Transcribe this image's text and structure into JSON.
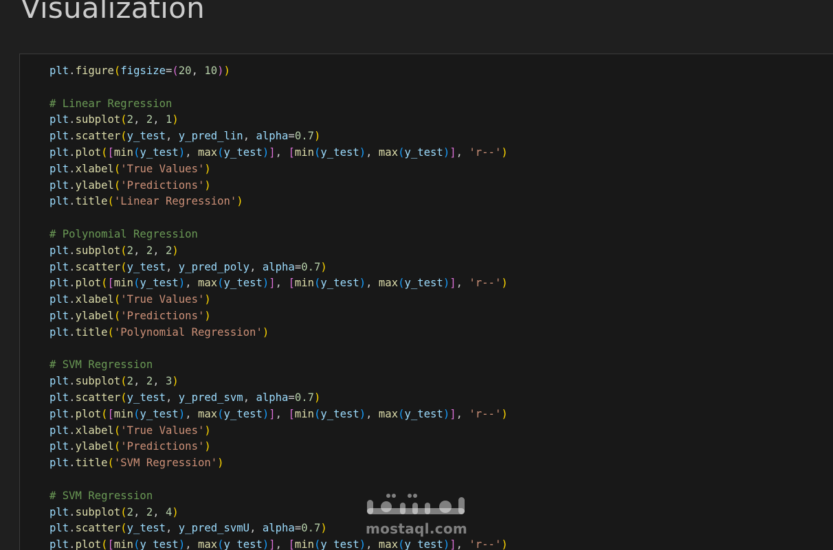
{
  "section": {
    "heading": "Visualization"
  },
  "code_cell": {
    "lines": [
      [
        [
          "plt",
          "var"
        ],
        [
          ".",
          "pun"
        ],
        [
          "figure",
          "fn"
        ],
        [
          "(",
          "b1"
        ],
        [
          "figsize",
          "var"
        ],
        [
          "=",
          "pun"
        ],
        [
          "(",
          "b2"
        ],
        [
          "20",
          "num"
        ],
        [
          ", ",
          "pun"
        ],
        [
          "10",
          "num"
        ],
        [
          ")",
          "b2"
        ],
        [
          ")",
          "b1"
        ]
      ],
      [],
      [
        [
          "# Linear Regression",
          "com"
        ]
      ],
      [
        [
          "plt",
          "var"
        ],
        [
          ".",
          "pun"
        ],
        [
          "subplot",
          "fn"
        ],
        [
          "(",
          "b1"
        ],
        [
          "2",
          "num"
        ],
        [
          ", ",
          "pun"
        ],
        [
          "2",
          "num"
        ],
        [
          ", ",
          "pun"
        ],
        [
          "1",
          "num"
        ],
        [
          ")",
          "b1"
        ]
      ],
      [
        [
          "plt",
          "var"
        ],
        [
          ".",
          "pun"
        ],
        [
          "scatter",
          "fn"
        ],
        [
          "(",
          "b1"
        ],
        [
          "y_test",
          "var"
        ],
        [
          ", ",
          "pun"
        ],
        [
          "y_pred_lin",
          "var"
        ],
        [
          ", ",
          "pun"
        ],
        [
          "alpha",
          "var"
        ],
        [
          "=",
          "pun"
        ],
        [
          "0.7",
          "num"
        ],
        [
          ")",
          "b1"
        ]
      ],
      [
        [
          "plt",
          "var"
        ],
        [
          ".",
          "pun"
        ],
        [
          "plot",
          "fn"
        ],
        [
          "(",
          "b1"
        ],
        [
          "[",
          "b2"
        ],
        [
          "min",
          "fn"
        ],
        [
          "(",
          "b3"
        ],
        [
          "y_test",
          "var"
        ],
        [
          ")",
          "b3"
        ],
        [
          ", ",
          "pun"
        ],
        [
          "max",
          "fn"
        ],
        [
          "(",
          "b3"
        ],
        [
          "y_test",
          "var"
        ],
        [
          ")",
          "b3"
        ],
        [
          "]",
          "b2"
        ],
        [
          ", ",
          "pun"
        ],
        [
          "[",
          "b2"
        ],
        [
          "min",
          "fn"
        ],
        [
          "(",
          "b3"
        ],
        [
          "y_test",
          "var"
        ],
        [
          ")",
          "b3"
        ],
        [
          ", ",
          "pun"
        ],
        [
          "max",
          "fn"
        ],
        [
          "(",
          "b3"
        ],
        [
          "y_test",
          "var"
        ],
        [
          ")",
          "b3"
        ],
        [
          "]",
          "b2"
        ],
        [
          ", ",
          "pun"
        ],
        [
          "'r--'",
          "str"
        ],
        [
          ")",
          "b1"
        ]
      ],
      [
        [
          "plt",
          "var"
        ],
        [
          ".",
          "pun"
        ],
        [
          "xlabel",
          "fn"
        ],
        [
          "(",
          "b1"
        ],
        [
          "'True Values'",
          "str"
        ],
        [
          ")",
          "b1"
        ]
      ],
      [
        [
          "plt",
          "var"
        ],
        [
          ".",
          "pun"
        ],
        [
          "ylabel",
          "fn"
        ],
        [
          "(",
          "b1"
        ],
        [
          "'Predictions'",
          "str"
        ],
        [
          ")",
          "b1"
        ]
      ],
      [
        [
          "plt",
          "var"
        ],
        [
          ".",
          "pun"
        ],
        [
          "title",
          "fn"
        ],
        [
          "(",
          "b1"
        ],
        [
          "'Linear Regression'",
          "str"
        ],
        [
          ")",
          "b1"
        ]
      ],
      [],
      [
        [
          "# Polynomial Regression",
          "com"
        ]
      ],
      [
        [
          "plt",
          "var"
        ],
        [
          ".",
          "pun"
        ],
        [
          "subplot",
          "fn"
        ],
        [
          "(",
          "b1"
        ],
        [
          "2",
          "num"
        ],
        [
          ", ",
          "pun"
        ],
        [
          "2",
          "num"
        ],
        [
          ", ",
          "pun"
        ],
        [
          "2",
          "num"
        ],
        [
          ")",
          "b1"
        ]
      ],
      [
        [
          "plt",
          "var"
        ],
        [
          ".",
          "pun"
        ],
        [
          "scatter",
          "fn"
        ],
        [
          "(",
          "b1"
        ],
        [
          "y_test",
          "var"
        ],
        [
          ", ",
          "pun"
        ],
        [
          "y_pred_poly",
          "var"
        ],
        [
          ", ",
          "pun"
        ],
        [
          "alpha",
          "var"
        ],
        [
          "=",
          "pun"
        ],
        [
          "0.7",
          "num"
        ],
        [
          ")",
          "b1"
        ]
      ],
      [
        [
          "plt",
          "var"
        ],
        [
          ".",
          "pun"
        ],
        [
          "plot",
          "fn"
        ],
        [
          "(",
          "b1"
        ],
        [
          "[",
          "b2"
        ],
        [
          "min",
          "fn"
        ],
        [
          "(",
          "b3"
        ],
        [
          "y_test",
          "var"
        ],
        [
          ")",
          "b3"
        ],
        [
          ", ",
          "pun"
        ],
        [
          "max",
          "fn"
        ],
        [
          "(",
          "b3"
        ],
        [
          "y_test",
          "var"
        ],
        [
          ")",
          "b3"
        ],
        [
          "]",
          "b2"
        ],
        [
          ", ",
          "pun"
        ],
        [
          "[",
          "b2"
        ],
        [
          "min",
          "fn"
        ],
        [
          "(",
          "b3"
        ],
        [
          "y_test",
          "var"
        ],
        [
          ")",
          "b3"
        ],
        [
          ", ",
          "pun"
        ],
        [
          "max",
          "fn"
        ],
        [
          "(",
          "b3"
        ],
        [
          "y_test",
          "var"
        ],
        [
          ")",
          "b3"
        ],
        [
          "]",
          "b2"
        ],
        [
          ", ",
          "pun"
        ],
        [
          "'r--'",
          "str"
        ],
        [
          ")",
          "b1"
        ]
      ],
      [
        [
          "plt",
          "var"
        ],
        [
          ".",
          "pun"
        ],
        [
          "xlabel",
          "fn"
        ],
        [
          "(",
          "b1"
        ],
        [
          "'True Values'",
          "str"
        ],
        [
          ")",
          "b1"
        ]
      ],
      [
        [
          "plt",
          "var"
        ],
        [
          ".",
          "pun"
        ],
        [
          "ylabel",
          "fn"
        ],
        [
          "(",
          "b1"
        ],
        [
          "'Predictions'",
          "str"
        ],
        [
          ")",
          "b1"
        ]
      ],
      [
        [
          "plt",
          "var"
        ],
        [
          ".",
          "pun"
        ],
        [
          "title",
          "fn"
        ],
        [
          "(",
          "b1"
        ],
        [
          "'Polynomial Regression'",
          "str"
        ],
        [
          ")",
          "b1"
        ]
      ],
      [],
      [
        [
          "# SVM Regression",
          "com"
        ]
      ],
      [
        [
          "plt",
          "var"
        ],
        [
          ".",
          "pun"
        ],
        [
          "subplot",
          "fn"
        ],
        [
          "(",
          "b1"
        ],
        [
          "2",
          "num"
        ],
        [
          ", ",
          "pun"
        ],
        [
          "2",
          "num"
        ],
        [
          ", ",
          "pun"
        ],
        [
          "3",
          "num"
        ],
        [
          ")",
          "b1"
        ]
      ],
      [
        [
          "plt",
          "var"
        ],
        [
          ".",
          "pun"
        ],
        [
          "scatter",
          "fn"
        ],
        [
          "(",
          "b1"
        ],
        [
          "y_test",
          "var"
        ],
        [
          ", ",
          "pun"
        ],
        [
          "y_pred_svm",
          "var"
        ],
        [
          ", ",
          "pun"
        ],
        [
          "alpha",
          "var"
        ],
        [
          "=",
          "pun"
        ],
        [
          "0.7",
          "num"
        ],
        [
          ")",
          "b1"
        ]
      ],
      [
        [
          "plt",
          "var"
        ],
        [
          ".",
          "pun"
        ],
        [
          "plot",
          "fn"
        ],
        [
          "(",
          "b1"
        ],
        [
          "[",
          "b2"
        ],
        [
          "min",
          "fn"
        ],
        [
          "(",
          "b3"
        ],
        [
          "y_test",
          "var"
        ],
        [
          ")",
          "b3"
        ],
        [
          ", ",
          "pun"
        ],
        [
          "max",
          "fn"
        ],
        [
          "(",
          "b3"
        ],
        [
          "y_test",
          "var"
        ],
        [
          ")",
          "b3"
        ],
        [
          "]",
          "b2"
        ],
        [
          ", ",
          "pun"
        ],
        [
          "[",
          "b2"
        ],
        [
          "min",
          "fn"
        ],
        [
          "(",
          "b3"
        ],
        [
          "y_test",
          "var"
        ],
        [
          ")",
          "b3"
        ],
        [
          ", ",
          "pun"
        ],
        [
          "max",
          "fn"
        ],
        [
          "(",
          "b3"
        ],
        [
          "y_test",
          "var"
        ],
        [
          ")",
          "b3"
        ],
        [
          "]",
          "b2"
        ],
        [
          ", ",
          "pun"
        ],
        [
          "'r--'",
          "str"
        ],
        [
          ")",
          "b1"
        ]
      ],
      [
        [
          "plt",
          "var"
        ],
        [
          ".",
          "pun"
        ],
        [
          "xlabel",
          "fn"
        ],
        [
          "(",
          "b1"
        ],
        [
          "'True Values'",
          "str"
        ],
        [
          ")",
          "b1"
        ]
      ],
      [
        [
          "plt",
          "var"
        ],
        [
          ".",
          "pun"
        ],
        [
          "ylabel",
          "fn"
        ],
        [
          "(",
          "b1"
        ],
        [
          "'Predictions'",
          "str"
        ],
        [
          ")",
          "b1"
        ]
      ],
      [
        [
          "plt",
          "var"
        ],
        [
          ".",
          "pun"
        ],
        [
          "title",
          "fn"
        ],
        [
          "(",
          "b1"
        ],
        [
          "'SVM Regression'",
          "str"
        ],
        [
          ")",
          "b1"
        ]
      ],
      [],
      [
        [
          "# SVM Regression",
          "com"
        ]
      ],
      [
        [
          "plt",
          "var"
        ],
        [
          ".",
          "pun"
        ],
        [
          "subplot",
          "fn"
        ],
        [
          "(",
          "b1"
        ],
        [
          "2",
          "num"
        ],
        [
          ", ",
          "pun"
        ],
        [
          "2",
          "num"
        ],
        [
          ", ",
          "pun"
        ],
        [
          "4",
          "num"
        ],
        [
          ")",
          "b1"
        ]
      ],
      [
        [
          "plt",
          "var"
        ],
        [
          ".",
          "pun"
        ],
        [
          "scatter",
          "fn"
        ],
        [
          "(",
          "b1"
        ],
        [
          "y_test",
          "var"
        ],
        [
          ", ",
          "pun"
        ],
        [
          "y_pred_svmU",
          "var"
        ],
        [
          ", ",
          "pun"
        ],
        [
          "alpha",
          "var"
        ],
        [
          "=",
          "pun"
        ],
        [
          "0.7",
          "num"
        ],
        [
          ")",
          "b1"
        ]
      ],
      [
        [
          "plt",
          "var"
        ],
        [
          ".",
          "pun"
        ],
        [
          "plot",
          "fn"
        ],
        [
          "(",
          "b1"
        ],
        [
          "[",
          "b2"
        ],
        [
          "min",
          "fn"
        ],
        [
          "(",
          "b3"
        ],
        [
          "y_test",
          "var"
        ],
        [
          ")",
          "b3"
        ],
        [
          ", ",
          "pun"
        ],
        [
          "max",
          "fn"
        ],
        [
          "(",
          "b3"
        ],
        [
          "y_test",
          "var"
        ],
        [
          ")",
          "b3"
        ],
        [
          "]",
          "b2"
        ],
        [
          ", ",
          "pun"
        ],
        [
          "[",
          "b2"
        ],
        [
          "min",
          "fn"
        ],
        [
          "(",
          "b3"
        ],
        [
          "y_test",
          "var"
        ],
        [
          ")",
          "b3"
        ],
        [
          ", ",
          "pun"
        ],
        [
          "max",
          "fn"
        ],
        [
          "(",
          "b3"
        ],
        [
          "y_test",
          "var"
        ],
        [
          ")",
          "b3"
        ],
        [
          "]",
          "b2"
        ],
        [
          ", ",
          "pun"
        ],
        [
          "'r--'",
          "str"
        ],
        [
          ")",
          "b1"
        ]
      ]
    ]
  },
  "watermark": {
    "logo_text": "مستقل",
    "domain_text": "mostaql.com"
  },
  "colors": {
    "page_background": "#1f1f1f",
    "cell_background": "#181818",
    "cell_border": "#3c3c3c",
    "heading": "#cccccc",
    "variable": "#9cdcfe",
    "function": "#dcdcaa",
    "number": "#b5cea8",
    "string": "#ce9178",
    "comment": "#6a9955",
    "bracket_level_1": "#ffd700",
    "bracket_level_2": "#da70d6",
    "bracket_level_3": "#179fff"
  }
}
